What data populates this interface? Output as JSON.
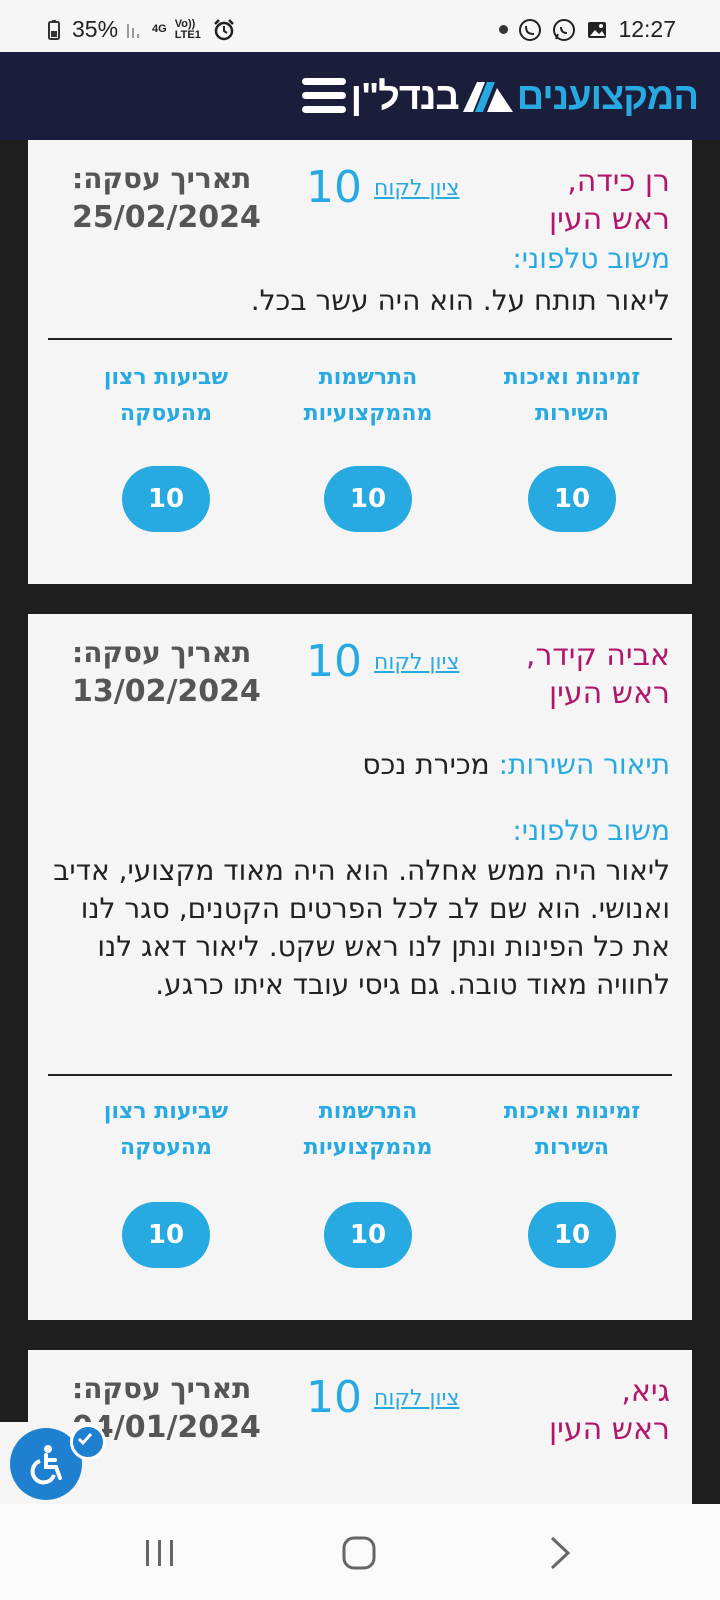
{
  "status_bar": {
    "battery": "35%",
    "network": "4G",
    "volte": "Vo)) LTE1",
    "time": "12:27"
  },
  "header": {
    "logo_part_a": "המקצוענים",
    "logo_part_b": "בנדל\"ן",
    "brand_color": "#27a9e1",
    "background": "#1a1e3a"
  },
  "reviews": [
    {
      "name": "רן כידה,",
      "city": "ראש העין",
      "score_link": "ציון לקוח",
      "score": "10",
      "date_label": "תאריך עסקה:",
      "date": "25/02/2024",
      "service_label": "",
      "service_value": "",
      "feedback_label": "משוב טלפוני:",
      "feedback": "ליאור תותח על. הוא היה עשר בכל.",
      "criteria": [
        {
          "label": "זמינות ואיכות השירות",
          "value": "10"
        },
        {
          "label": "התרשמות מהמקצועיות",
          "value": "10"
        },
        {
          "label": "שביעות רצון מהעסקה",
          "value": "10"
        }
      ]
    },
    {
      "name": "אביה קידר,",
      "city": "ראש העין",
      "score_link": "ציון לקוח",
      "score": "10",
      "date_label": "תאריך עסקה:",
      "date": "13/02/2024",
      "service_label": "תיאור השירות:",
      "service_value": "מכירת נכס",
      "feedback_label": "משוב טלפוני:",
      "feedback": "ליאור היה ממש אחלה. הוא היה מאוד מקצועי, אדיב ואנושי. הוא שם לב לכל הפרטים הקטנים, סגר לנו את כל הפינות ונתן לנו ראש שקט. ליאור דאג לנו לחוויה מאוד טובה. גם גיסי עובד איתו כרגע.",
      "criteria": [
        {
          "label": "זמינות ואיכות השירות",
          "value": "10"
        },
        {
          "label": "התרשמות מהמקצועיות",
          "value": "10"
        },
        {
          "label": "שביעות רצון מהעסקה",
          "value": "10"
        }
      ]
    },
    {
      "name": "גיא,",
      "city": "ראש העין",
      "score_link": "ציון לקוח",
      "score": "10",
      "date_label": "תאריך עסקה:",
      "date": "04/01/2024"
    }
  ],
  "accessibility_button": "accessibility-icon",
  "nav": [
    "recent-apps-icon",
    "home-icon",
    "back-icon"
  ]
}
